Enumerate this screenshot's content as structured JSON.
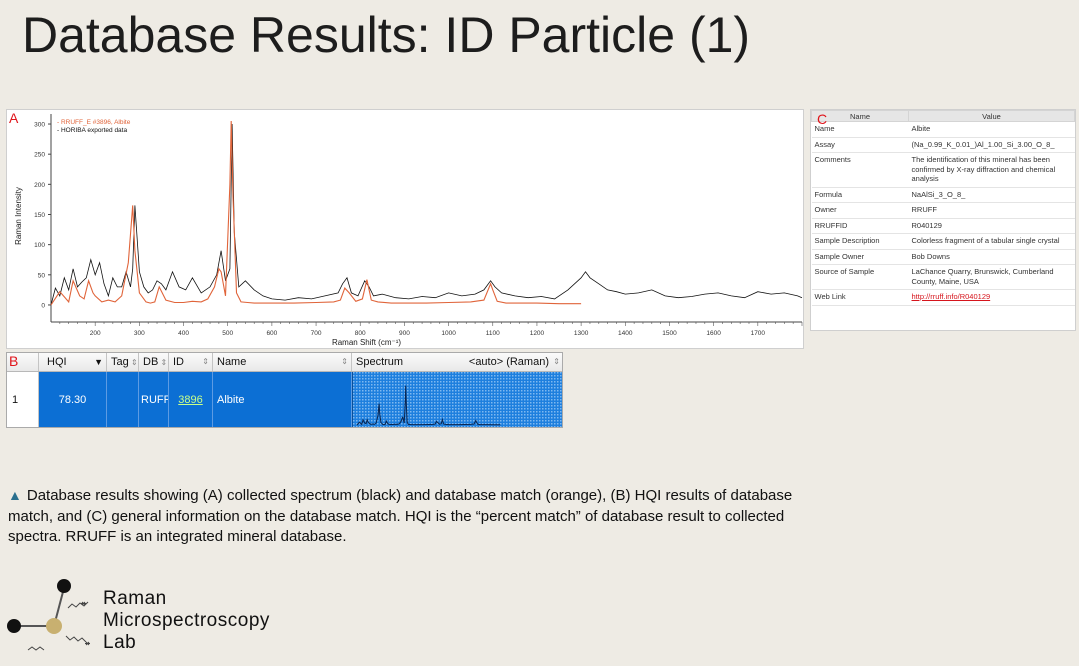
{
  "title": "Database Results: ID Particle (1)",
  "panel_a": {
    "letter": "A",
    "legend": [
      "- RRUFF_E #3896, Albite",
      "- HORIBA exported data"
    ],
    "ylabel": "Raman Intensity",
    "xlabel": "Raman Shift (cm⁻¹)",
    "y_ticks": [
      "300",
      "250",
      "200",
      "150",
      "100",
      "50",
      "0"
    ],
    "x_ticks": [
      "200",
      "300",
      "400",
      "500",
      "600",
      "700",
      "800",
      "900",
      "1000",
      "1100",
      "1200",
      "1300",
      "1400",
      "1500",
      "1600",
      "1700"
    ],
    "colors": {
      "collected": "#111111",
      "database": "#e0643a"
    }
  },
  "chart_data": {
    "type": "line",
    "xlabel": "Raman Shift (cm⁻¹)",
    "ylabel": "Raman Intensity",
    "xlim": [
      100,
      1800
    ],
    "ylim": [
      -15,
      310
    ],
    "series": [
      {
        "name": "RRUFF_E #3896, Albite",
        "x": [
          100,
          120,
          140,
          150,
          165,
          175,
          185,
          195,
          200,
          215,
          230,
          245,
          260,
          275,
          285,
          290,
          300,
          315,
          325,
          335,
          345,
          360,
          380,
          400,
          420,
          440,
          455,
          470,
          480,
          485,
          495,
          505,
          508,
          512,
          520,
          530,
          545,
          560,
          600,
          650,
          700,
          740,
          755,
          765,
          775,
          790,
          805,
          815,
          825,
          840,
          870,
          900,
          950,
          1000,
          1050,
          1080,
          1095,
          1100,
          1110,
          1130,
          1170,
          1200,
          1250,
          1300
        ],
        "y": [
          0,
          22,
          5,
          40,
          15,
          10,
          40,
          20,
          15,
          5,
          8,
          5,
          15,
          70,
          165,
          90,
          20,
          5,
          3,
          5,
          30,
          8,
          4,
          4,
          6,
          5,
          10,
          30,
          60,
          55,
          15,
          200,
          305,
          180,
          20,
          5,
          4,
          3,
          3,
          3,
          4,
          5,
          8,
          28,
          20,
          6,
          10,
          42,
          8,
          5,
          3,
          3,
          3,
          4,
          5,
          8,
          35,
          25,
          6,
          3,
          3,
          3,
          2,
          2
        ]
      },
      {
        "name": "HORIBA exported data",
        "x": [
          100,
          110,
          120,
          130,
          140,
          150,
          160,
          170,
          180,
          190,
          200,
          210,
          220,
          230,
          240,
          250,
          260,
          270,
          280,
          285,
          290,
          300,
          310,
          320,
          330,
          340,
          350,
          360,
          375,
          390,
          405,
          420,
          440,
          460,
          475,
          485,
          495,
          505,
          510,
          515,
          525,
          540,
          560,
          580,
          600,
          630,
          660,
          690,
          720,
          750,
          760,
          770,
          780,
          795,
          810,
          820,
          830,
          850,
          880,
          910,
          940,
          970,
          1000,
          1030,
          1060,
          1080,
          1095,
          1105,
          1120,
          1150,
          1180,
          1210,
          1240,
          1270,
          1300,
          1310,
          1320,
          1340,
          1360,
          1380,
          1400,
          1430,
          1460,
          1490,
          1520,
          1550,
          1580,
          1610,
          1640,
          1670,
          1700,
          1730,
          1760,
          1790,
          1800
        ],
        "y": [
          0,
          28,
          15,
          45,
          25,
          60,
          30,
          38,
          45,
          75,
          50,
          70,
          35,
          15,
          45,
          30,
          30,
          55,
          30,
          60,
          165,
          55,
          30,
          20,
          25,
          40,
          35,
          25,
          55,
          30,
          25,
          45,
          20,
          30,
          50,
          90,
          40,
          60,
          300,
          120,
          30,
          40,
          25,
          15,
          10,
          8,
          12,
          10,
          15,
          20,
          35,
          45,
          20,
          15,
          40,
          30,
          15,
          18,
          12,
          10,
          14,
          12,
          20,
          15,
          18,
          25,
          40,
          30,
          20,
          15,
          12,
          14,
          10,
          25,
          45,
          55,
          45,
          35,
          25,
          22,
          18,
          20,
          25,
          15,
          12,
          14,
          18,
          20,
          15,
          12,
          22,
          18,
          20,
          15,
          12
        ]
      }
    ]
  },
  "panel_b": {
    "letter": "B",
    "headers": {
      "hqi": "HQI",
      "tag": "Tag",
      "db": "DB",
      "id": "ID",
      "name": "Name",
      "spectrum": "Spectrum",
      "spectrum_mode": "<auto> (Raman)"
    },
    "row": {
      "index": "1",
      "hqi": "78.30",
      "tag": "",
      "db": "RUFF_",
      "id": "3896",
      "name": "Albite"
    }
  },
  "panel_c": {
    "letter": "C",
    "headers": {
      "name": "Name",
      "value": "Value"
    },
    "rows": [
      {
        "k": "Name",
        "v": "Albite"
      },
      {
        "k": "Assay",
        "v": "(Na_0.99_K_0.01_)Al_1.00_Si_3.00_O_8_"
      },
      {
        "k": "Comments",
        "v": "The identification of this mineral has been confirmed by X-ray diffraction and chemical analysis"
      },
      {
        "k": "Formula",
        "v": "NaAlSi_3_O_8_"
      },
      {
        "k": "Owner",
        "v": "RRUFF"
      },
      {
        "k": "RRUFFID",
        "v": "R040129"
      },
      {
        "k": "Sample Description",
        "v": "Colorless fragment of a tabular single crystal"
      },
      {
        "k": "Sample Owner",
        "v": "Bob Downs"
      },
      {
        "k": "Source of Sample",
        "v": "LaChance Quarry, Brunswick, Cumberland County, Maine, USA"
      },
      {
        "k": "Web Link",
        "v": "http://rruff.info/R040129"
      }
    ]
  },
  "caption": "Database results showing (A) collected spectrum (black) and database match (orange), (B) HQI results of database match, and (C) general information on the database match. HQI is the “percent match” of database result to collected spectra. RRUFF is an integrated mineral database.",
  "logo": {
    "line1": "Raman",
    "line2": "Microspectroscopy",
    "line3": "Lab"
  },
  "colors": {
    "selection": "#0c6fd4",
    "accent_red": "#e0141b",
    "bullet": "#2a6f8e"
  }
}
